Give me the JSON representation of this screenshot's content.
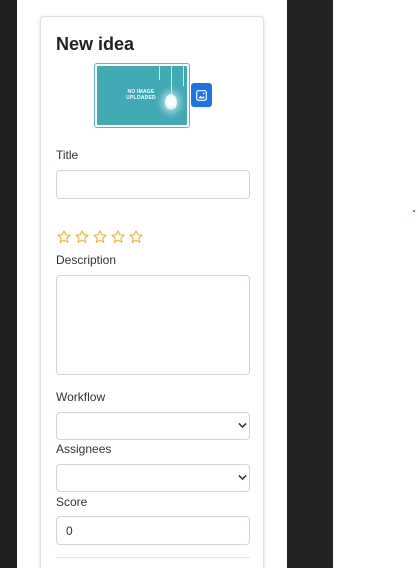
{
  "form": {
    "title": "New idea",
    "image_placeholder": "NO IMAGE UPLOADED",
    "title_label": "Title",
    "title_value": "",
    "rating": 0,
    "rating_max": 5,
    "description_label": "Description",
    "description_value": "",
    "workflow_label": "Workflow",
    "workflow_value": "",
    "assignees_label": "Assignees",
    "assignees_value": "",
    "score_label": "Score",
    "score_value": "0"
  },
  "colors": {
    "accent": "#1a73e8",
    "star": "#f0b429",
    "image_bg": "#3fa9b4",
    "sidebar_dark": "#1e1e1e"
  },
  "icons": {
    "upload": "image-icon",
    "rating": "star-icon",
    "select": "chevron-down-icon"
  }
}
